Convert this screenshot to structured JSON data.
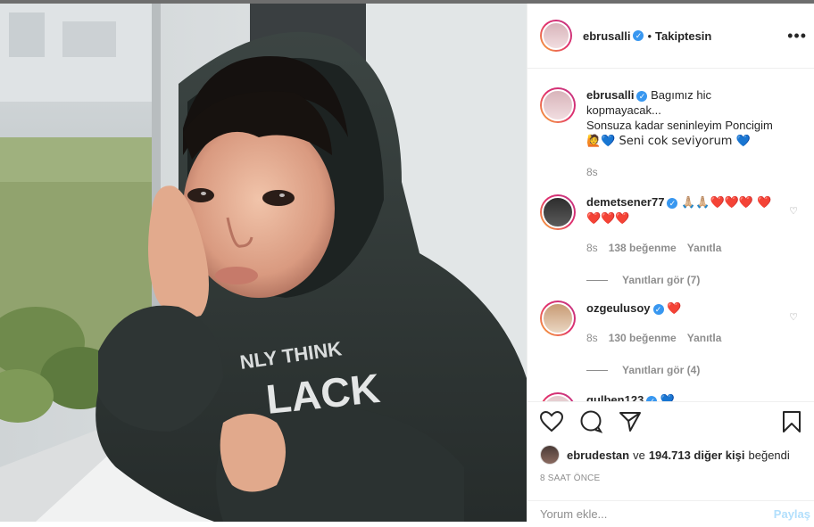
{
  "post": {
    "owner_username": "ebrusalli",
    "follow_status": "Takiptesin",
    "more_label": "•••"
  },
  "caption": {
    "username": "ebrusalli",
    "text_line1": "Bagımız hic kopmayacak...",
    "text_line2": "Sonsuza kadar seninleyim Poncigim",
    "emoji_line": "🙋💙 Seni cok seviyorum 💙",
    "time": "8s"
  },
  "comments": [
    {
      "username": "demetsener77",
      "text": "🙏🏼🙏🏼❤️❤️❤️ ❤️❤️❤️❤️",
      "time": "8s",
      "likes": "138 beğenme",
      "reply": "Yanıtla",
      "view_replies": "Yanıtları gör (7)"
    },
    {
      "username": "ozgeulusoy",
      "text": "❤️",
      "time": "8s",
      "likes": "130 beğenme",
      "reply": "Yanıtla",
      "view_replies": "Yanıtları gör (4)"
    },
    {
      "username": "gulben123",
      "text": "💙"
    }
  ],
  "likes": {
    "first_user": "ebrudestan",
    "connector": "ve",
    "others": "194.713 diğer kişi",
    "suffix": "beğendi"
  },
  "timestamp": "8 SAAT ÖNCE",
  "add_comment": {
    "placeholder": "Yorum ekle...",
    "submit": "Paylaş"
  },
  "colors": {
    "verified": "#3897f0",
    "heart": "#ed4956",
    "submit_disabled": "#b2dffc"
  }
}
